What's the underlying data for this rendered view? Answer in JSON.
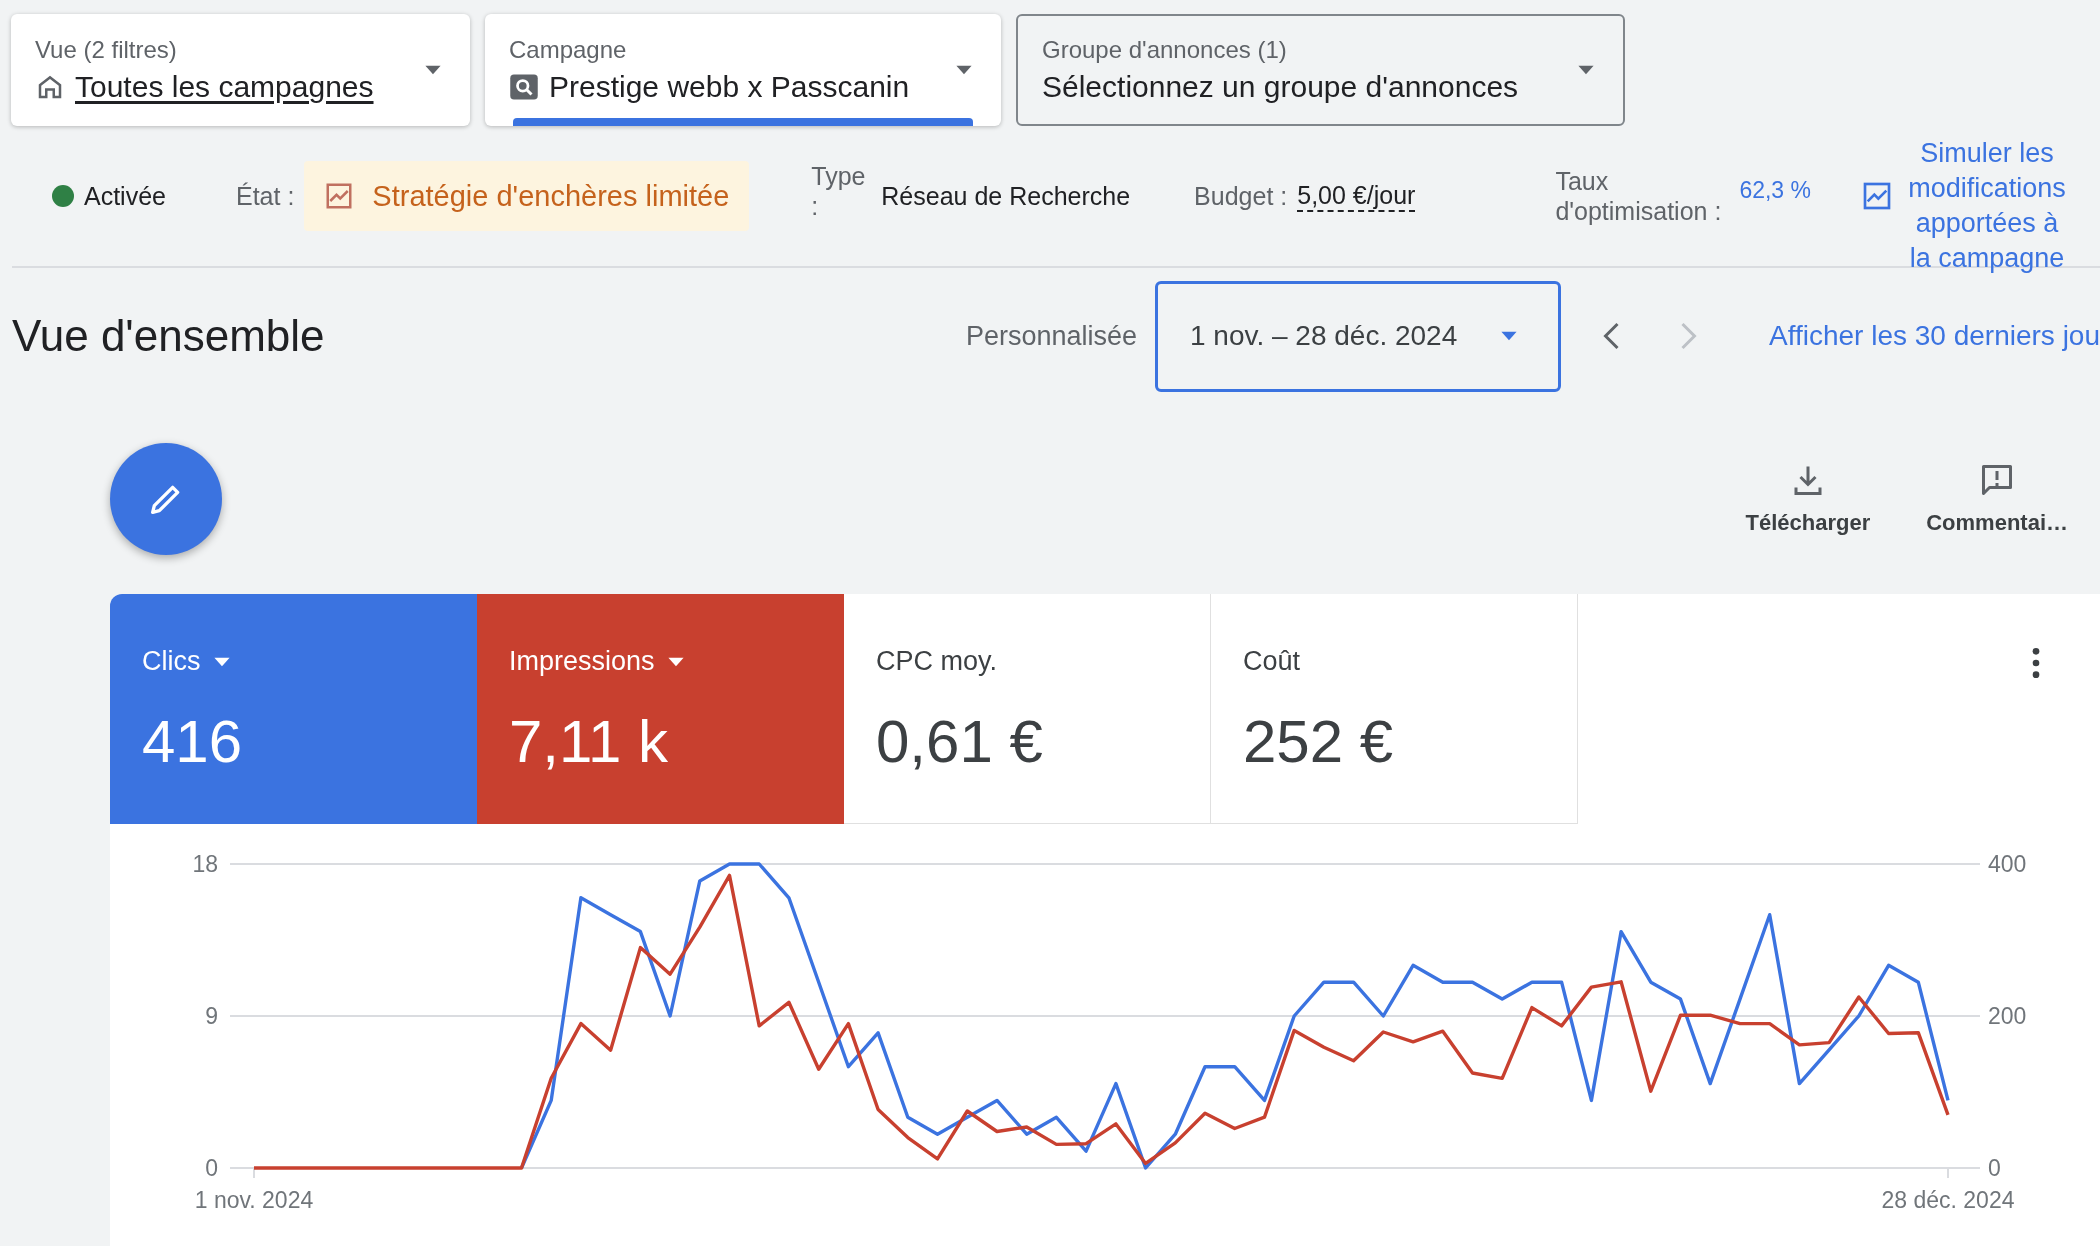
{
  "filters": [
    {
      "label": "Vue (2 filtres)",
      "value": "Toutes les campagnes",
      "kind": "view",
      "selected": false
    },
    {
      "label": "Campagne",
      "value": "Prestige webb x Passcanin",
      "kind": "campaign",
      "selected": true
    },
    {
      "label": "Groupe d'annonces (1)",
      "value": "Sélectionnez un groupe d'annonces",
      "kind": "adgroup",
      "selected": false
    }
  ],
  "status": {
    "state": "Activée",
    "color": "#2f8045",
    "etat_label": "État :",
    "strategy": "Stratégie d'enchères limitée",
    "type_label": "Type :",
    "type_value": "Réseau de Recherche",
    "budget_label": "Budget :",
    "budget_value": "5,00 €/jour",
    "opt_label": "Taux d'optimisation :",
    "opt_value": "62,3 %",
    "simulate_link": "Simuler les modifications apportées à la campagne"
  },
  "overview": {
    "title": "Vue d'ensemble",
    "range_label": "Personnalisée",
    "date_range": "1 nov. – 28 déc. 2024",
    "prev_disabled": false,
    "next_disabled": true,
    "link": "Afficher les 30 derniers jou"
  },
  "tools": [
    {
      "label": "Télécharger",
      "kind": "download"
    },
    {
      "label": "Commentai…",
      "kind": "feedback"
    }
  ],
  "metrics": [
    {
      "label": "Clics",
      "value": "416",
      "selected": true,
      "color": "#3b73e0"
    },
    {
      "label": "Impressions",
      "value": "7,11 k",
      "selected": true,
      "color": "#c8402f"
    },
    {
      "label": "CPC moy.",
      "value": "0,61 €",
      "selected": false
    },
    {
      "label": "Coût",
      "value": "252 €",
      "selected": false
    }
  ],
  "chart_data": {
    "type": "line",
    "categories": [
      "1 nov. 2024",
      null,
      null,
      null,
      null,
      null,
      null,
      null,
      null,
      null,
      null,
      null,
      null,
      null,
      null,
      null,
      null,
      null,
      null,
      null,
      null,
      null,
      null,
      null,
      null,
      null,
      null,
      null,
      null,
      null,
      null,
      null,
      null,
      null,
      null,
      null,
      null,
      null,
      null,
      null,
      null,
      null,
      null,
      null,
      null,
      null,
      null,
      null,
      null,
      null,
      null,
      null,
      null,
      null,
      null,
      null,
      null,
      "28 déc. 2024"
    ],
    "yticks": [
      0,
      9,
      18
    ],
    "y2ticks": [
      0,
      200,
      400
    ],
    "ylim": [
      0,
      18
    ],
    "y2lim": [
      0,
      400
    ],
    "series": [
      {
        "color": "#3b73e0",
        "values": [
          null,
          null,
          null,
          null,
          null,
          null,
          null,
          null,
          null,
          0,
          4,
          16,
          15,
          14,
          9,
          17,
          18,
          18,
          16,
          11,
          6,
          8,
          3,
          2,
          3,
          4,
          2,
          3,
          1,
          5,
          0,
          2,
          6,
          6,
          4,
          9,
          11,
          11,
          9,
          12,
          11,
          11,
          10,
          11,
          11,
          4,
          14,
          11,
          10,
          5,
          10,
          15,
          5,
          7,
          9,
          12,
          11,
          4
        ]
      },
      {
        "color": "#c8402f",
        "axis": "y2",
        "values": [
          0,
          0,
          0,
          0,
          0,
          0,
          0,
          0,
          0,
          0,
          118,
          190,
          155,
          290,
          255,
          317,
          385,
          187,
          218,
          130,
          190,
          77,
          40,
          12,
          75,
          48,
          54,
          31,
          32,
          58,
          6,
          33,
          72,
          52,
          67,
          181,
          159,
          141,
          179,
          166,
          180,
          125,
          118,
          211,
          187,
          238,
          245,
          101,
          201,
          201,
          190,
          190,
          162,
          165,
          225,
          177,
          178,
          70
        ]
      }
    ]
  }
}
